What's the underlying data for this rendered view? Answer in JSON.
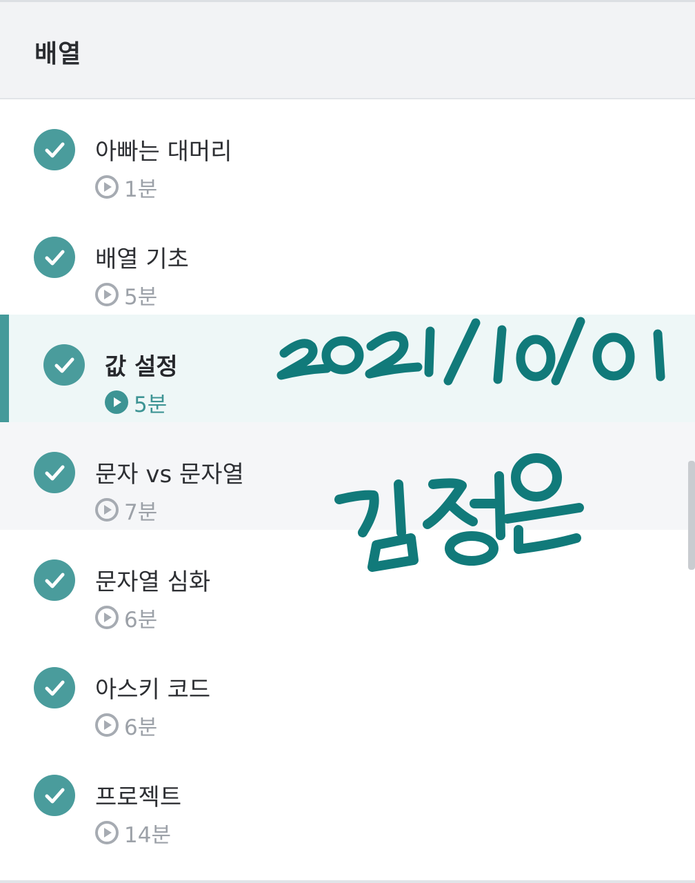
{
  "header": {
    "title": "배열"
  },
  "lessons": [
    {
      "title": "아빠는 대머리",
      "duration": "1분",
      "completed": true,
      "state": "default"
    },
    {
      "title": "배열 기초",
      "duration": "5분",
      "completed": true,
      "state": "default"
    },
    {
      "title": "값 설정",
      "duration": "5분",
      "completed": true,
      "state": "active"
    },
    {
      "title": "문자 vs 문자열",
      "duration": "7분",
      "completed": true,
      "state": "hovered"
    },
    {
      "title": "문자열 심화",
      "duration": "6분",
      "completed": true,
      "state": "default"
    },
    {
      "title": "아스키 코드",
      "duration": "6분",
      "completed": true,
      "state": "default"
    },
    {
      "title": "프로젝트",
      "duration": "14분",
      "completed": true,
      "state": "default"
    }
  ],
  "annotation": {
    "date": "2021/10/01",
    "name": "김정은"
  },
  "icons": {
    "completed": "check-circle-icon",
    "duration": "play-circle-icon"
  },
  "colors": {
    "accent": "#449a9a",
    "check": "#4a9c9c",
    "active_background": "#eef7f7",
    "muted_text": "#9ca1a8",
    "handwriting": "#117a7a"
  }
}
